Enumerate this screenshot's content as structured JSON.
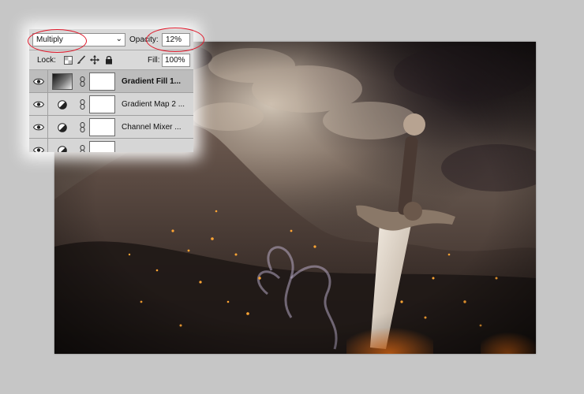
{
  "layers_panel": {
    "blend_mode": "Multiply",
    "opacity_label": "Opacity:",
    "opacity_value": "12%",
    "lock_label": "Lock:",
    "fill_label": "Fill:",
    "fill_value": "100%",
    "lock_icons": [
      "transparency-lock-icon",
      "brush-lock-icon",
      "move-lock-icon",
      "padlock-icon"
    ],
    "layers": [
      {
        "name": "Gradient Fill 1...",
        "thumbnail": "gradient-fill",
        "visible": true,
        "selected": true
      },
      {
        "name": "Gradient Map 2 ...",
        "thumbnail": "adjustment",
        "visible": true,
        "selected": false
      },
      {
        "name": "Channel Mixer ...",
        "thumbnail": "adjustment",
        "visible": true,
        "selected": false
      },
      {
        "name": "",
        "thumbnail": "adjustment",
        "visible": true,
        "selected": false
      }
    ]
  },
  "annotations": {
    "color": "#e0182a",
    "highlighted": [
      "blend-mode-dropdown",
      "opacity-field"
    ]
  },
  "canvas": {
    "description_colors": {
      "sky": "#5e4f46",
      "rock": "#3a2e29",
      "sword": "#e7dccf",
      "ember": "#ff9a2a"
    }
  }
}
